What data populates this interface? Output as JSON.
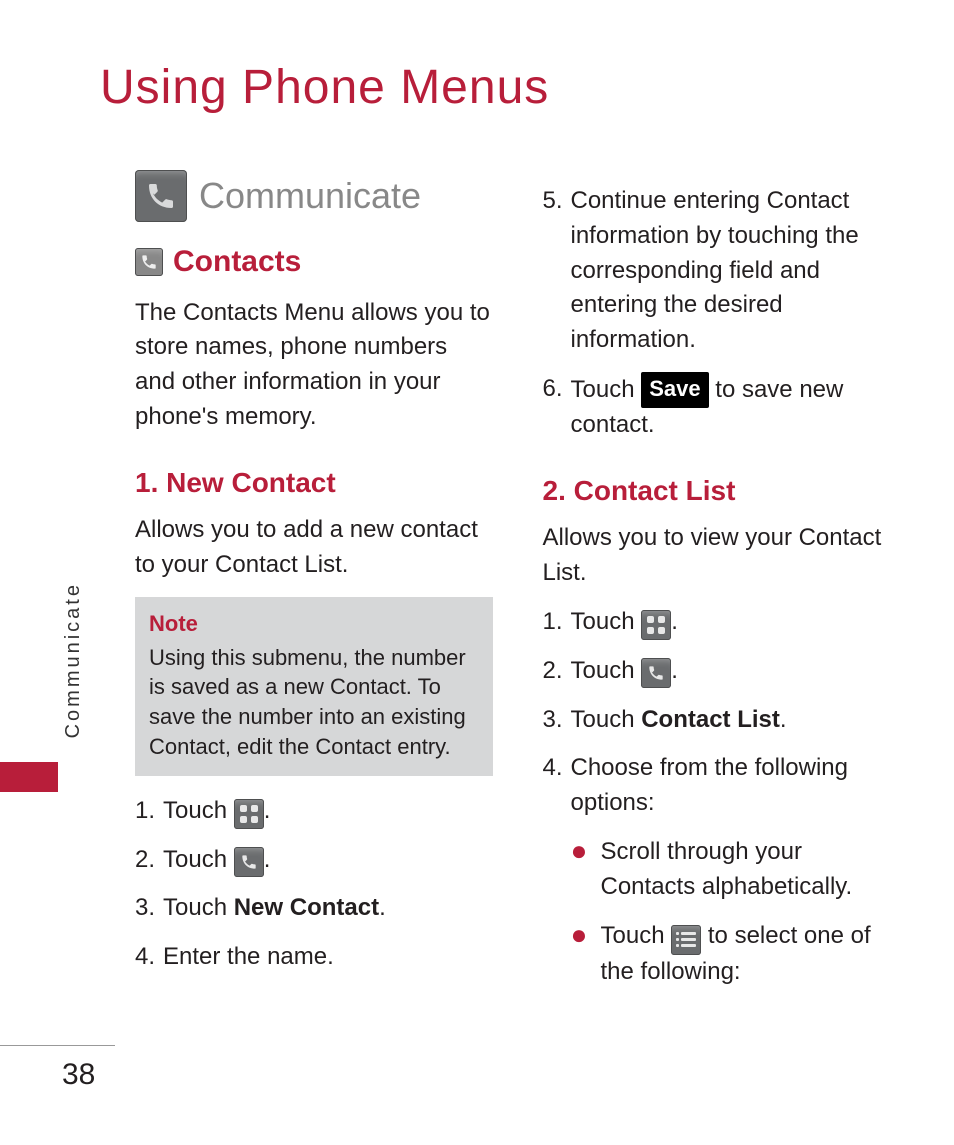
{
  "page": {
    "title": "Using Phone Menus",
    "side_label": "Communicate",
    "number": "38"
  },
  "left": {
    "section_title": "Communicate",
    "contacts_heading": "Contacts",
    "contacts_intro": "The Contacts Menu allows you to store names, phone numbers and other information in your phone's memory.",
    "new_contact_heading": "1. New Contact",
    "new_contact_intro": "Allows you to add a new contact to your Contact List.",
    "note_title": "Note",
    "note_body": "Using this submenu, the number is saved as a new Contact. To save the number into an existing Contact, edit the Contact entry.",
    "steps": {
      "s1_pre": "Touch ",
      "s1_post": ".",
      "s2_pre": "Touch ",
      "s2_post": ".",
      "s3_pre": "Touch ",
      "s3_bold": "New Contact",
      "s3_post": ".",
      "s4": "Enter the name."
    }
  },
  "right": {
    "step5": "Continue entering Contact information by touching the corresponding field and entering the desired information.",
    "step6_pre": "Touch ",
    "save_label": "Save",
    "step6_post": " to save new contact.",
    "contact_list_heading": "2. Contact List",
    "contact_list_intro": "Allows you to view your Contact List.",
    "s1_pre": "Touch ",
    "s1_post": ".",
    "s2_pre": "Touch ",
    "s2_post": ".",
    "s3_pre": "Touch ",
    "s3_bold": "Contact List",
    "s3_post": ".",
    "s4": "Choose from the following options:",
    "b1": "Scroll through your Contacts alphabetically.",
    "b2_pre": "Touch ",
    "b2_post": " to select one of the following:"
  }
}
